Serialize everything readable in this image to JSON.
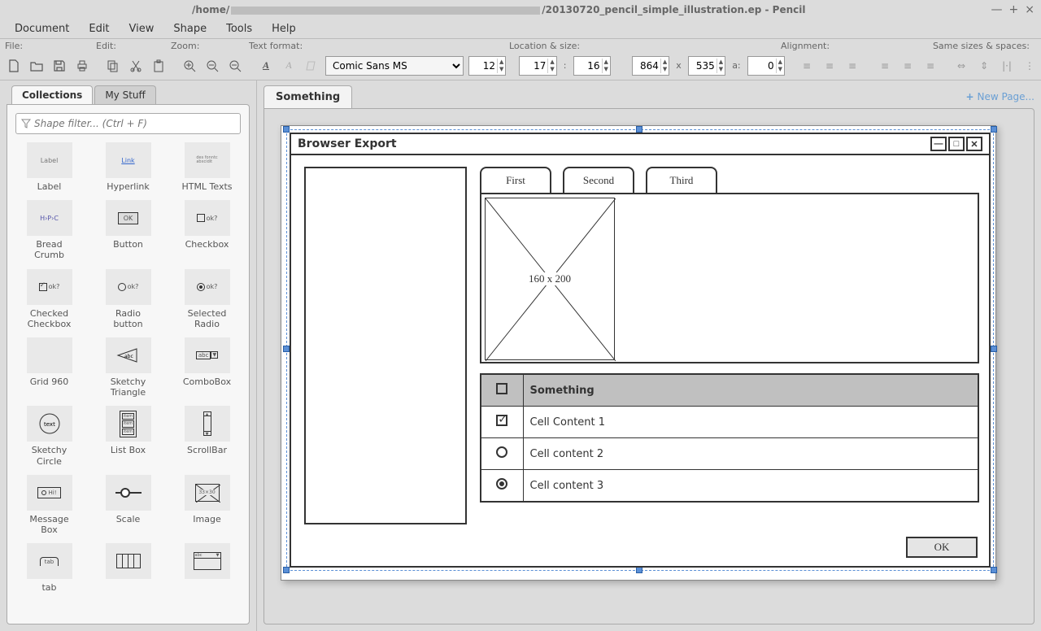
{
  "window": {
    "title_prefix": "/home/",
    "title_suffix": "/20130720_pencil_simple_illustration.ep - Pencil"
  },
  "menu": [
    "Document",
    "Edit",
    "View",
    "Shape",
    "Tools",
    "Help"
  ],
  "toolbar_labels": {
    "file": "File:",
    "edit": "Edit:",
    "zoom": "Zoom:",
    "textformat": "Text format:",
    "locsize": "Location & size:",
    "alignment": "Alignment:",
    "samesizes": "Same sizes & spaces:"
  },
  "text_format": {
    "font": "Comic Sans MS",
    "size": "12"
  },
  "location": {
    "x": "17",
    "y": "16",
    "w": "864",
    "h": "535",
    "angle": "0"
  },
  "loc_separators": {
    "colon": ":",
    "times": "x",
    "angle_label": "a:"
  },
  "sidebar": {
    "tab1": "Collections",
    "tab2": "My Stuff",
    "filter_placeholder": "Shape filter... (Ctrl + F)",
    "shapes": [
      {
        "label": "Label"
      },
      {
        "label": "Hyperlink"
      },
      {
        "label": "HTML Texts"
      },
      {
        "label": "Bread Crumb"
      },
      {
        "label": "Button"
      },
      {
        "label": "Checkbox"
      },
      {
        "label": "Checked Checkbox"
      },
      {
        "label": "Radio button"
      },
      {
        "label": "Selected Radio"
      },
      {
        "label": "Grid 960"
      },
      {
        "label": "Sketchy Triangle"
      },
      {
        "label": "ComboBox"
      },
      {
        "label": "Sketchy Circle"
      },
      {
        "label": "List Box"
      },
      {
        "label": "ScrollBar"
      },
      {
        "label": "Message Box"
      },
      {
        "label": "Scale"
      },
      {
        "label": "Image"
      },
      {
        "label": "tab"
      },
      {
        "label": ""
      },
      {
        "label": ""
      }
    ]
  },
  "canvas": {
    "tab": "Something",
    "newpage": "New Page..."
  },
  "mockup": {
    "title": "Browser Export",
    "tabs": [
      "First",
      "Second",
      "Third"
    ],
    "image_dim": "160 x 200",
    "table_header": "Something",
    "rows": [
      "Cell Content 1",
      "Cell content 2",
      "Cell content 3"
    ],
    "ok": "OK"
  }
}
